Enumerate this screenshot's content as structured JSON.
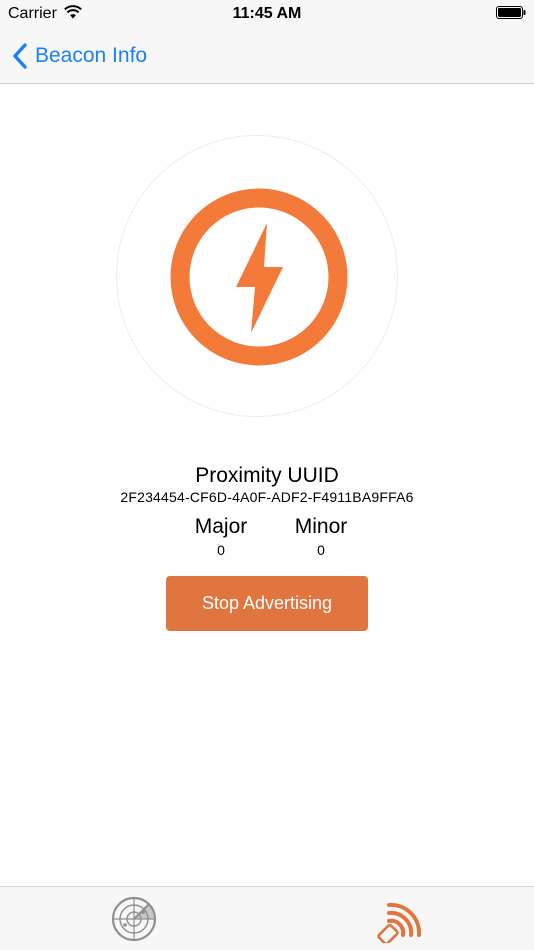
{
  "status_bar": {
    "carrier": "Carrier",
    "time": "11:45 AM"
  },
  "nav": {
    "back_label": "Beacon Info"
  },
  "beacon": {
    "uuid_title": "Proximity UUID",
    "uuid_value": "2F234454-CF6D-4A0F-ADF2-F4911BA9FFA6",
    "major_label": "Major",
    "major_value": "0",
    "minor_label": "Minor",
    "minor_value": "0",
    "stop_button_label": "Stop Advertising"
  },
  "tabs": [
    {
      "icon": "radar-icon",
      "selected": false
    },
    {
      "icon": "broadcast-icon",
      "selected": true
    }
  ],
  "colors": {
    "accent": "#1a80f5",
    "beacon_orange": "#f47a3a",
    "button_orange": "#e1753f",
    "tab_inactive": "#8e8e8e",
    "tab_active": "#e1753f"
  }
}
